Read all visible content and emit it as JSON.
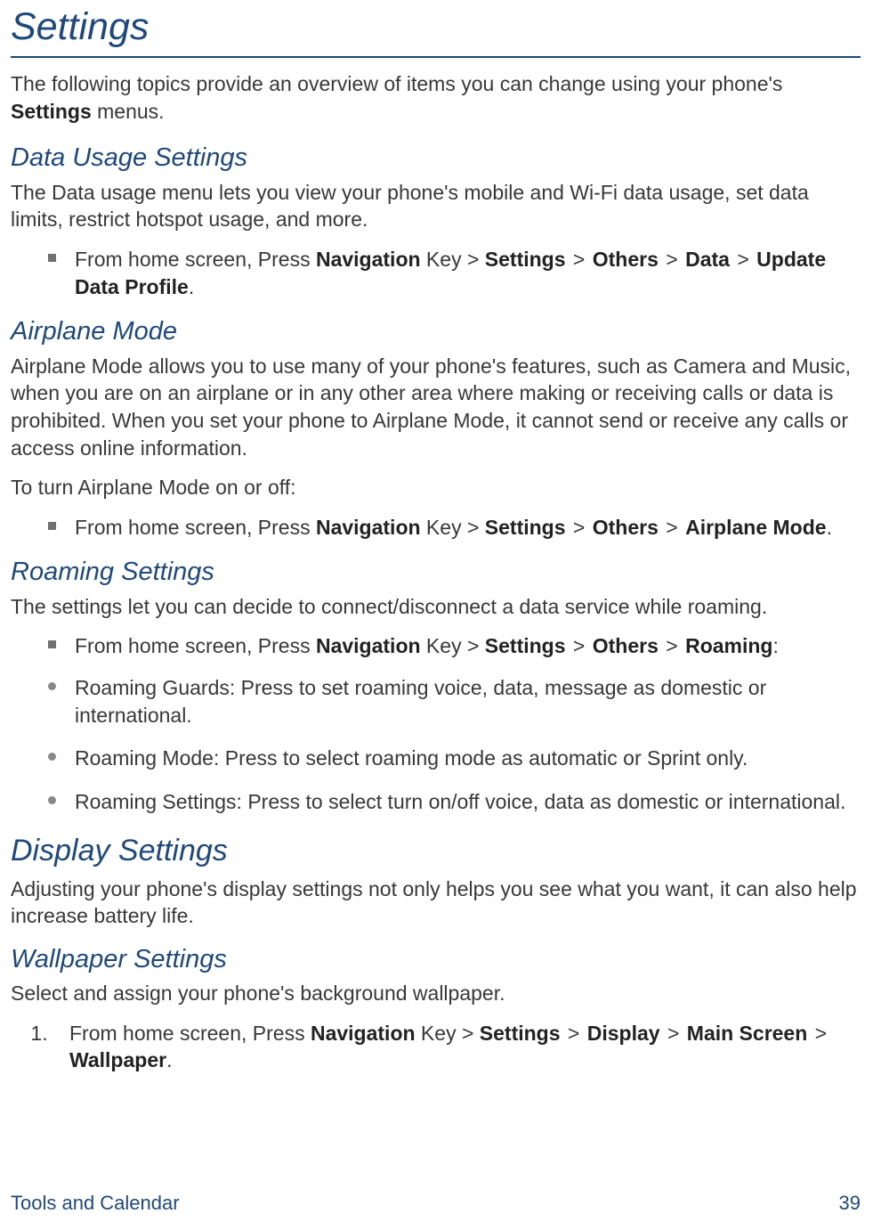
{
  "title": "Settings",
  "intro_pre": "The following topics provide an overview of items you can change using your phone's ",
  "intro_bold": "Settings",
  "intro_post": " menus.",
  "s1": {
    "head": "Data Usage Settings",
    "body": "The Data usage menu lets you view your phone's mobile and Wi-Fi data usage, set data limits, restrict hotspot usage, and more.",
    "bullet_pre": "From home screen, Press ",
    "nav": "Navigation",
    "key": " Key > ",
    "settings": "Settings",
    "gt": " > ",
    "others": "Others",
    "data": "Data",
    "update": "Update Data Profile",
    "dot": "."
  },
  "s2": {
    "head": "Airplane Mode",
    "body": "Airplane Mode allows you to use many of your phone's features, such as Camera and Music, when you are on an airplane or in any other area where making or receiving calls or data is prohibited. When you set your phone to Airplane Mode, it cannot send or receive any calls or access online information.",
    "body2": "To turn Airplane Mode on or off:",
    "bullet_pre": "From home screen, Press ",
    "nav": "Navigation",
    "key": " Key > ",
    "settings": "Settings",
    "gt": " > ",
    "others": "Others",
    "airplane": "Airplane Mode",
    "dot": "."
  },
  "s3": {
    "head": "Roaming Settings",
    "body": "The settings let you can decide to connect/disconnect a data service while roaming.",
    "b1_pre": "From home screen, Press ",
    "nav": "Navigation",
    "key": " Key > ",
    "settings": "Settings",
    "gt": " > ",
    "others": "Others",
    "roaming": "Roaming",
    "colon": ":",
    "b2": "Roaming Guards: Press to set roaming voice, data, message as domestic or international.",
    "b3": "Roaming Mode: Press to select roaming mode as automatic or Sprint only.",
    "b4": "Roaming Settings: Press to select turn on/off voice, data as domestic or international."
  },
  "s4": {
    "head": "Display Settings",
    "body": "Adjusting your phone's display settings not only helps you see what you want, it can also help increase battery life."
  },
  "s5": {
    "head": "Wallpaper Settings",
    "body": "Select and assign your phone's background wallpaper.",
    "o1_pre": "From home screen, Press ",
    "nav": "Navigation",
    "key": " Key > ",
    "settings": "Settings",
    "gt": " > ",
    "display": "Display",
    "main": "Main Screen",
    "wallpaper": "Wallpaper",
    "dot": "."
  },
  "footer": {
    "left": "Tools and Calendar",
    "right": "39"
  }
}
